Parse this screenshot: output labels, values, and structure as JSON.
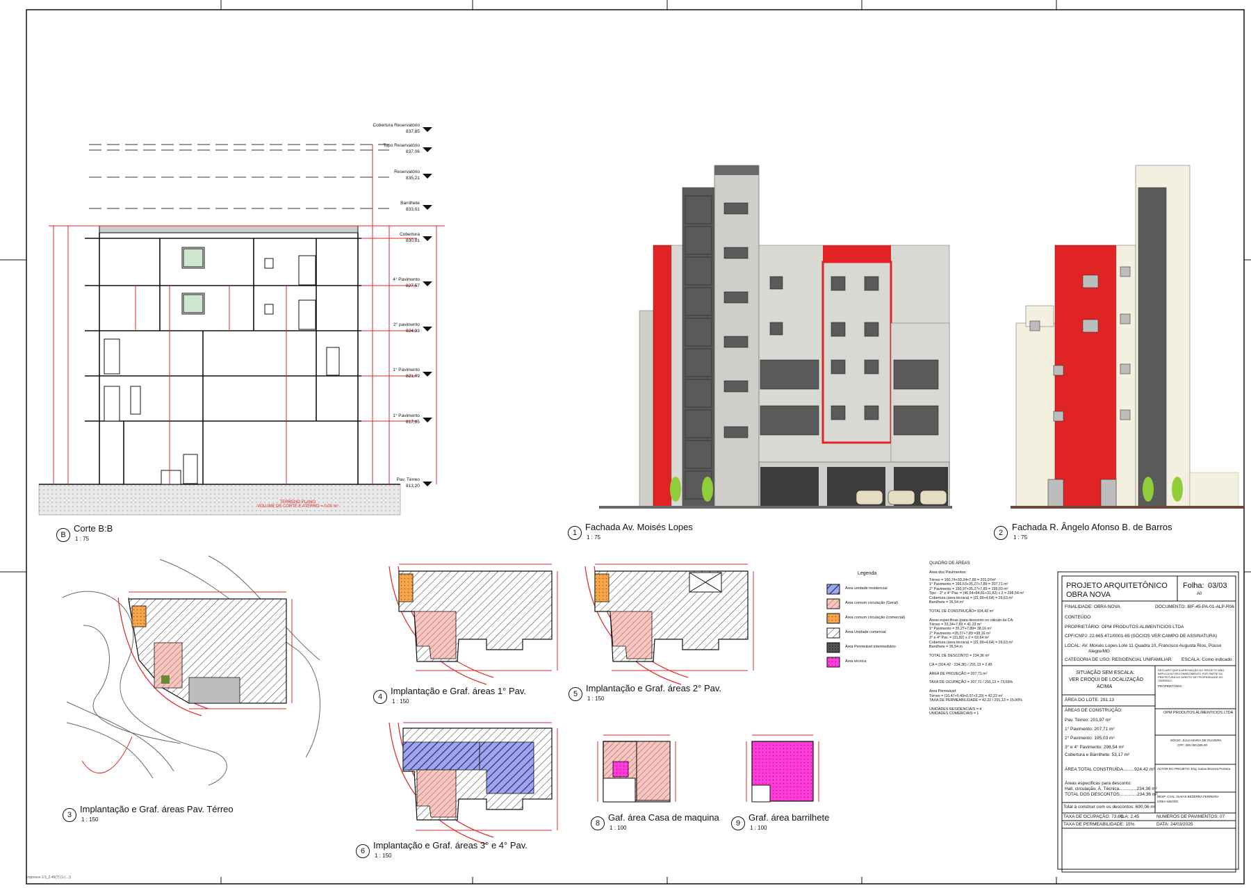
{
  "colors": {
    "red": "#e02424",
    "grey": "#d9d9d4",
    "dark": "#5a5a5a",
    "cream": "#f4f0e0",
    "blue": "#3a3aa8",
    "orange": "#f39a3a",
    "magenta": "#ff2bd6",
    "wall": "#3b3b3b"
  },
  "views": {
    "section": {
      "num": "B",
      "title": "Corte B:B",
      "scale": "1 : 75"
    },
    "front": {
      "num": "1",
      "title": "Fachada Av. Moisés Lopes",
      "scale": "1 : 75"
    },
    "side": {
      "num": "2",
      "title": "Fachada R. Ângelo Afonso B. de Barros",
      "scale": "1 : 75"
    },
    "ground": {
      "num": "3",
      "title": "Implantação e Graf. áreas Pav. Térreo",
      "scale": "1 : 150"
    },
    "first": {
      "num": "4",
      "title": "Implantação e Graf. áreas 1° Pav.",
      "scale": "1 : 150"
    },
    "second": {
      "num": "5",
      "title": "Implantação e Graf. áreas 2° Pav.",
      "scale": "1 : 150"
    },
    "third": {
      "num": "6",
      "title": "Implantação e Graf. áreas 3° e 4° Pav.",
      "scale": "1 : 150"
    },
    "machine": {
      "num": "8",
      "title": "Gaf. área Casa de maquina",
      "scale": "1 : 100"
    },
    "barrilhete": {
      "num": "9",
      "title": "Graf. área barrilhete",
      "scale": "1 : 100"
    }
  },
  "levels": [
    {
      "name": "Cobertura Reservatório",
      "elev": "837,85"
    },
    {
      "name": "Topo Reservatório",
      "elev": "837,06"
    },
    {
      "name": "Reservatório",
      "elev": "835,21"
    },
    {
      "name": "Barrilhete",
      "elev": "833,01"
    },
    {
      "name": "Cobertura",
      "elev": "830,81"
    },
    {
      "name": "4° Pavimento",
      "elev": "827,57"
    },
    {
      "name": "2° pavimento",
      "elev": "824,33"
    },
    {
      "name": "1° Pavimento",
      "elev": "821,09"
    },
    {
      "name": "1° Pavimento",
      "elev": "817,85"
    },
    {
      "name": "Pav. Térreo",
      "elev": "813,20"
    }
  ],
  "section_note": [
    "TERRENO PLANO",
    "VOLUME DE CORTE E ATERRO = 0,00 m³"
  ],
  "legend": {
    "title": "Legenda",
    "items": [
      {
        "label": "Área unidade residencial",
        "color": "#3a3aa8"
      },
      {
        "label": "Área comum circulação (Geral)",
        "color": "#e88a80"
      },
      {
        "label": "Área comum circulação (comercial)",
        "color": "#f39a3a"
      },
      {
        "label": "Área Unidade comercial",
        "color": "#bdbdbd"
      },
      {
        "label": "Área Permeável intermediário",
        "color": "#444444"
      },
      {
        "label": "Área técnica",
        "color": "#ff2bd6"
      }
    ]
  },
  "quadro": {
    "title": "QUADRO DE ÁREAS",
    "subtitle": "Área dos Pavimentos:",
    "lines": [
      "Térreo = 160,74+33,34+7,89 = 201,97m²",
      "1° Pavimento = 166,53+35,27+7,89 = 207,71 m²",
      "2° Pavimento = 150,97+35,27+7,89 = 195,03 m²",
      "Tipo - 3° e 4° Pav. = (46,64+84,81+31,82) x 2 = 298,54 m²",
      "Cobertura (área técnica) = (21,99+4,64) = 26,63 m²",
      "Barrilhete = 26,54 m²",
      "",
      "TOTAL DE CONSTRUÇÃO= 924,42 m²",
      "",
      "Áreas específicas (para desconto no cálculo da CA:",
      "Térreo = 33,34+7,89 = 41,23 m²",
      "1° Pavimento = 35,27+7,89= 38,16 m²",
      "2° Pavimento =35,27+7,89 =38,16 m²",
      "3° e 4° Pav. = (31,82) x 2 = 63,64 m²",
      "Cobertura (área técnica) = (21,99+4,64) = 26,63 m²",
      "Barrilhete = 26,54 m",
      "",
      "TOTAL DE DESCONTO = 234,36 m²",
      "",
      "CA = (924,42 - 234,36) / 291,13 = 2,45",
      "",
      "ÁREA DE PROJEÇÃO = 207,71 m²",
      "",
      "TAXA DE OCUPAÇÃO = 207,71 / 291,13 = 73,69%",
      "",
      "Área Permeável:",
      "Térreo = (10,47+5,49+0,97+3,29) = 42,22 m²",
      "TAXA DE PERMEABILIDADE = 42,22 / 291,13 = 15,00%",
      "",
      "UNIDADES RESIDENCIAIS = 4",
      "UNIDADES COMERCIAIS = 1"
    ]
  },
  "title_block": {
    "project": "PROJETO ARQUITETÔNICO",
    "project2": "OBRA NOVA",
    "sheet_label": "Folha:",
    "sheet": "03/03",
    "format": "A0",
    "finalidade": "FINALIDADE:  OBRA NOVA",
    "documento": "DOCUMENTO: IBF-45-PA-01-ALP-R06",
    "conteudo": "CONTEÚDO:",
    "proprietario": "PROPRIETÁRIO:   OPM PRODUTOS ALIMENTICIOS LTDA",
    "cpf": "CPF/CNPJ: 22.665.471/0001-65   (SÓCIOS VER CAMPO DE ASSINATURA)",
    "local1": "LOCAL:     AV. Moisés Lopes Lote 11 Quadra 10, Francisco Augusta Rios, Pouso",
    "local2": "Alegre/MG",
    "categoria": "CATEGORIA DE USO:  RESIDENCIAL UNIFAMILIAR",
    "escala": "ESCALA:  Como indicado",
    "situacao1": "SITUAÇÃO SEM ESCALA:",
    "situacao2": "VER CROQUI DE LOCALIZAÇÃO",
    "situacao3": "ACIMA",
    "declaro": "DECLARO QUE A APROVAÇÃO DO PROJETO NÃO IMPLICA NO RECONHECIMENTO POR PARTE DA PREFEITURA DO DIREITO DE PROPRIEDADE DO TERRENO.",
    "proprietario_sig": "PROPRIETÁRIO:",
    "area_lote": "ÁREA DO LOTE:   291.13",
    "areas_title": "ÁREAS DE CONSTRUÇÃO:",
    "areas": [
      "Pav. Térreo: 201,97 m²",
      "1° Pavimento: 207,71 m²",
      "2° Pavimento: 195,03 m²",
      "3° e 4° Pavimento: 298,54 m²",
      "Cobertura e Barrilhete: 53,17 m²"
    ],
    "area_total": "ÁREA TOTAL CONSTRUÍDA.........924,42 m²",
    "desconto_title": "Áreas específicas para desconto:",
    "desconto1": "Hall, circulação, Á. Técnica..............234,36 m²",
    "desconto2": "TOTAL DOS DESCONTOS..............234,36 m²",
    "total_construir": "Total à construir com os descontos:   690,06 m²",
    "opm": "OPM PRODUTOS ALIMENTICIOS LTDA",
    "socio": "SÓCIO: JÚLIA MARIA DE OLIVEIRA",
    "socio_cpf": "CPF: 000.000.000-00",
    "autor": "AUTOR DO PROJETO:    Eng. Isaías Bezerra Ferreira",
    "resp": "RESP. CIVIL: ISAÍAS BEZERRA FERREIRA",
    "crea": "CREA-MG/000",
    "taxa_ocup": "TAXA DE OCUPAÇÃO:  73,6%",
    "ca": "C.A:    2,45",
    "num_pav": "NUMEROS DE PAVIMENTOS: 07",
    "taxa_perm": "TAXA DE PERMEABILIDADE:      15%",
    "data": "DATA:    24/03/2025"
  },
  "footer_note": "Impresso 2.5_2.46(?) (1-(...))"
}
